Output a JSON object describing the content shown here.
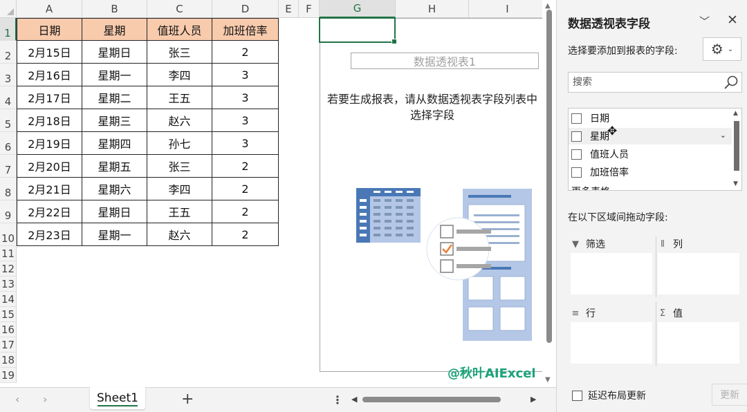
{
  "sheet": {
    "columns": [
      "A",
      "B",
      "C",
      "D",
      "E",
      "F",
      "G",
      "H",
      "I"
    ],
    "rows": [
      "1",
      "2",
      "3",
      "4",
      "5",
      "6",
      "7",
      "8",
      "9",
      "10",
      "11",
      "12",
      "13",
      "14",
      "15",
      "16",
      "17",
      "18",
      "19"
    ],
    "table_header": [
      "日期",
      "星期",
      "值班人员",
      "加班倍率"
    ],
    "table_rows": [
      [
        "2月15日",
        "星期日",
        "张三",
        "2"
      ],
      [
        "2月16日",
        "星期一",
        "李四",
        "3"
      ],
      [
        "2月17日",
        "星期二",
        "王五",
        "3"
      ],
      [
        "2月18日",
        "星期三",
        "赵六",
        "3"
      ],
      [
        "2月19日",
        "星期四",
        "孙七",
        "3"
      ],
      [
        "2月20日",
        "星期五",
        "张三",
        "2"
      ],
      [
        "2月21日",
        "星期六",
        "李四",
        "2"
      ],
      [
        "2月22日",
        "星期日",
        "王五",
        "2"
      ],
      [
        "2月23日",
        "星期一",
        "赵六",
        "2"
      ]
    ],
    "header_fill": "#f8cbad",
    "accent": "#217346"
  },
  "pivot": {
    "title": "数据透视表1",
    "message": "若要生成报表，请从数据透视表字段列表中选择字段"
  },
  "watermark": "@秋叶AIExcel",
  "bottom": {
    "sheet_tab": "Sheet1",
    "add_sheet": "+",
    "more": "⋮"
  },
  "pane": {
    "title": "数据透视表字段",
    "choose_label": "选择要添加到报表的字段:",
    "search_placeholder": "搜索",
    "fields": [
      "日期",
      "星期",
      "值班人员",
      "加班倍率"
    ],
    "more_tables": "更多表格...",
    "drag_label": "在以下区域间拖动字段:",
    "areas": {
      "filter": "筛选",
      "columns": "列",
      "rows": "行",
      "values": "值"
    },
    "defer_label": "延迟布局更新",
    "update_button": "更新"
  }
}
